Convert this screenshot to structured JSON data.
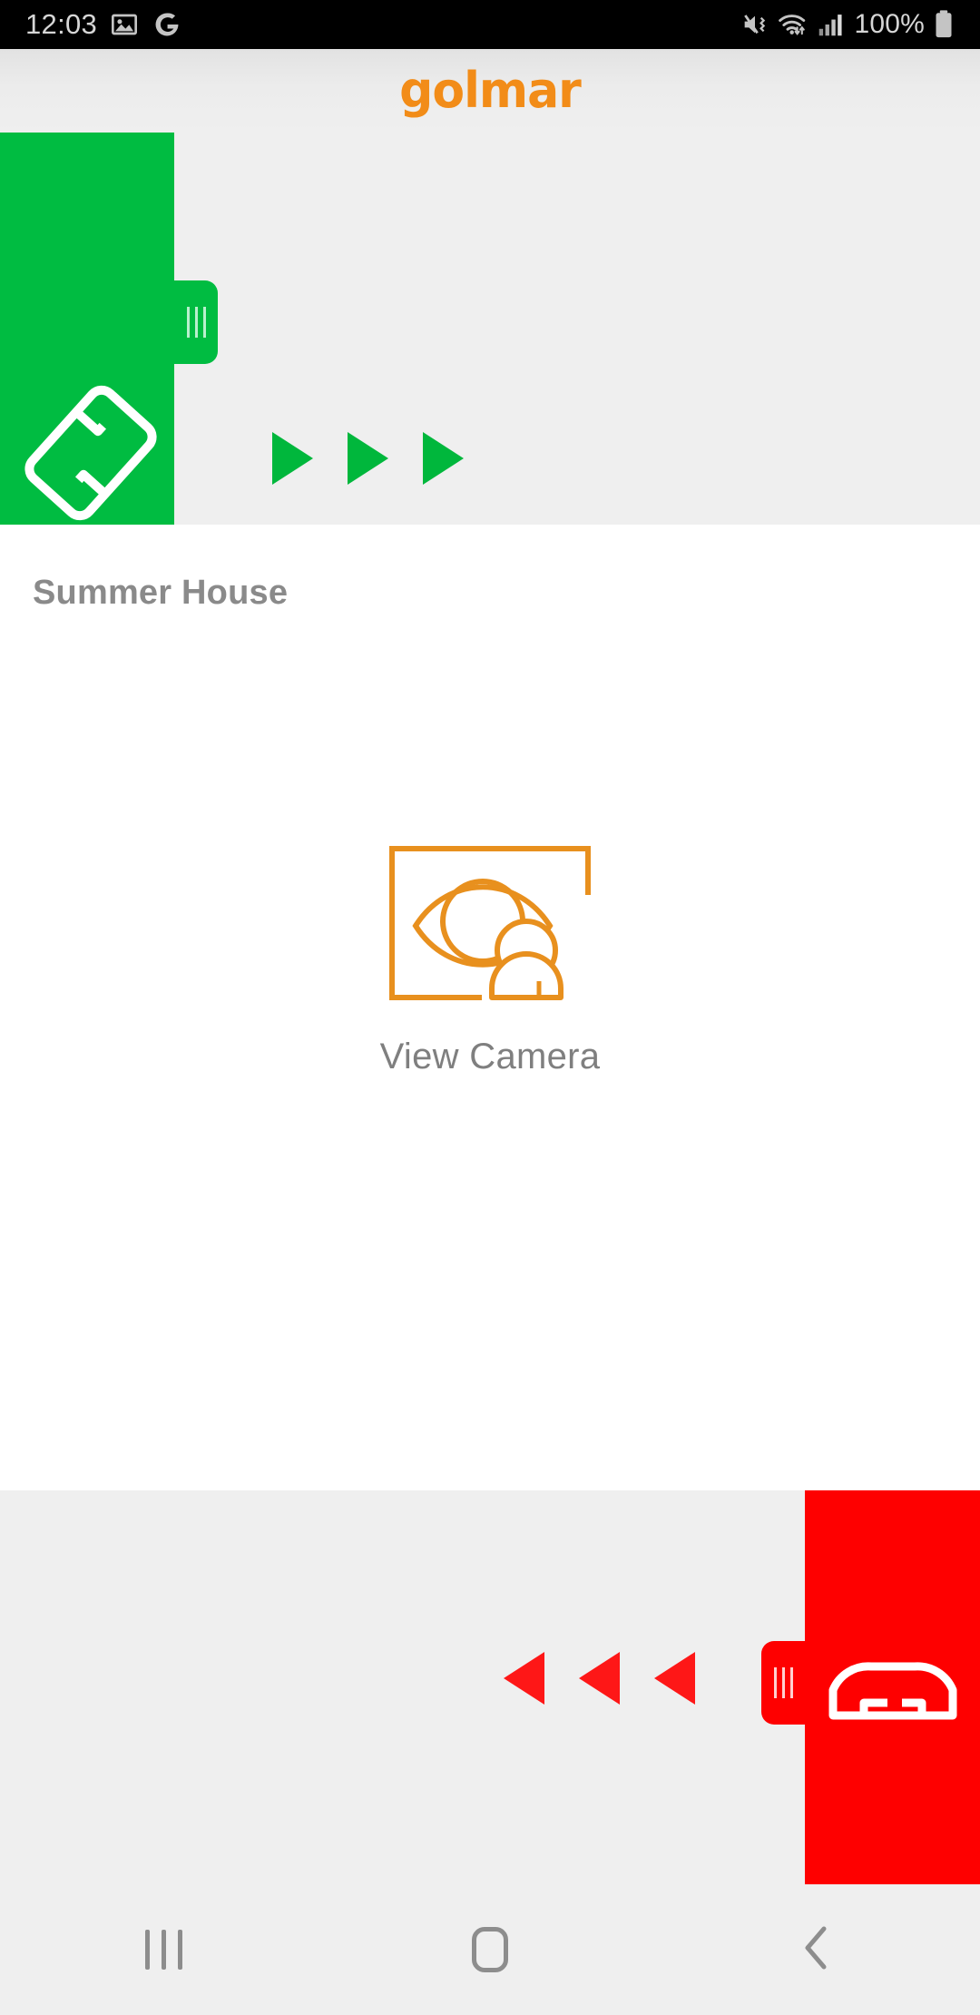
{
  "status_bar": {
    "time": "12:03",
    "battery_percent": "100%",
    "icons_left": [
      "photo-icon",
      "google-icon"
    ],
    "icons_right": [
      "vibrate-mute-icon",
      "wifi-icon",
      "signal-icon",
      "battery-icon"
    ]
  },
  "header": {
    "brand": "golmar",
    "brand_color": "#F28C18"
  },
  "answer_slider": {
    "icon": "phone-handset-icon",
    "handle": "drag-handle-grip",
    "direction_arrows": "arrow-right",
    "arrow_count": 3,
    "panel_color": "#00BC41",
    "arrow_color": "#00B73C"
  },
  "main": {
    "device_name": "Summer House",
    "camera_button": {
      "label": "View Camera",
      "icon": "view-camera-icon",
      "icon_color": "#E8901E"
    }
  },
  "hangup_slider": {
    "icon": "hangup-phone-icon",
    "handle": "drag-handle-grip",
    "direction_arrows": "arrow-left",
    "arrow_count": 3,
    "panel_color": "#FE0000",
    "arrow_color": "#FE1717"
  },
  "nav_bar": {
    "recents": "recents-icon",
    "home": "home-icon",
    "back": "back-icon"
  }
}
